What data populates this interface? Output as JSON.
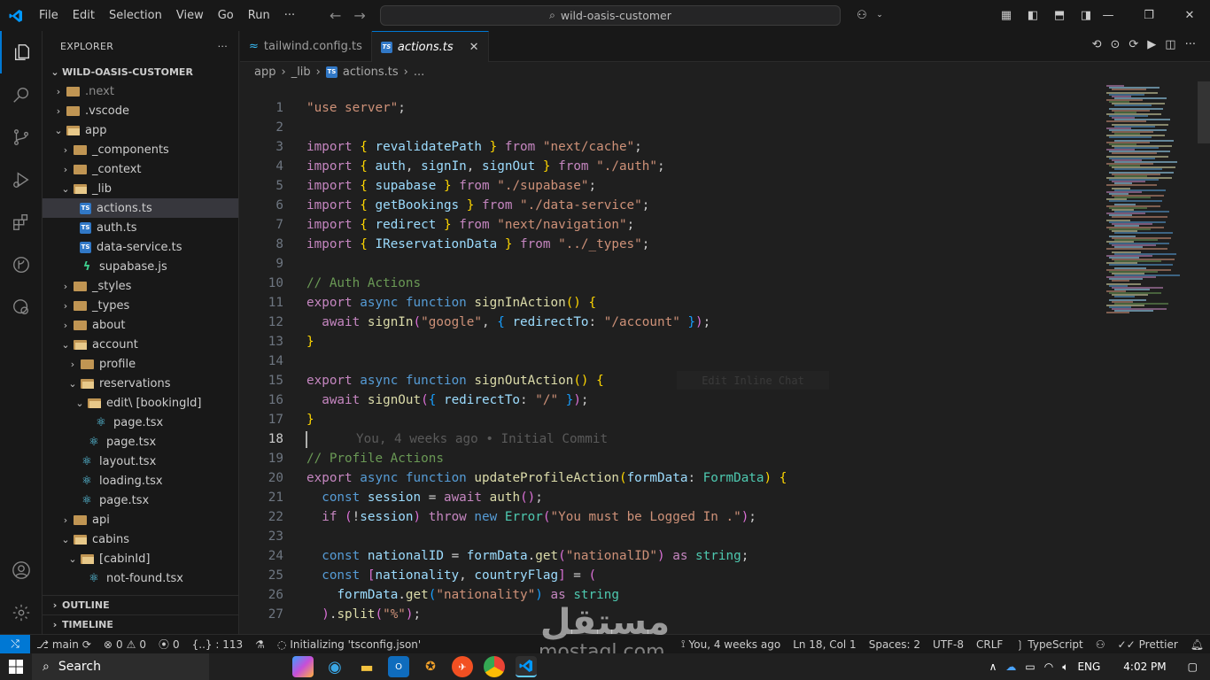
{
  "titlebar": {
    "menu": [
      "File",
      "Edit",
      "Selection",
      "View",
      "Go",
      "Run",
      "···"
    ],
    "command_center": "wild-oasis-customer"
  },
  "sidebar": {
    "title": "EXPLORER",
    "more": "···",
    "project": "WILD-OASIS-CUSTOMER",
    "tree": [
      {
        "label": ".next",
        "depth": 1,
        "chev": "›",
        "icon": "folder"
      },
      {
        "label": ".vscode",
        "depth": 1,
        "chev": "›",
        "icon": "folder"
      },
      {
        "label": "app",
        "depth": 1,
        "chev": "⌄",
        "icon": "folder-open"
      },
      {
        "label": "_components",
        "depth": 2,
        "chev": "›",
        "icon": "folder"
      },
      {
        "label": "_context",
        "depth": 2,
        "chev": "›",
        "icon": "folder"
      },
      {
        "label": "_lib",
        "depth": 2,
        "chev": "⌄",
        "icon": "folder-open"
      },
      {
        "label": "actions.ts",
        "depth": 3,
        "chev": "",
        "icon": "ts",
        "selected": true
      },
      {
        "label": "auth.ts",
        "depth": 3,
        "chev": "",
        "icon": "ts"
      },
      {
        "label": "data-service.ts",
        "depth": 3,
        "chev": "",
        "icon": "ts"
      },
      {
        "label": "supabase.js",
        "depth": 3,
        "chev": "",
        "icon": "supabase"
      },
      {
        "label": "_styles",
        "depth": 2,
        "chev": "›",
        "icon": "folder"
      },
      {
        "label": "_types",
        "depth": 2,
        "chev": "›",
        "icon": "folder"
      },
      {
        "label": "about",
        "depth": 2,
        "chev": "›",
        "icon": "folder"
      },
      {
        "label": "account",
        "depth": 2,
        "chev": "⌄",
        "icon": "folder-open"
      },
      {
        "label": "profile",
        "depth": 3,
        "chev": "›",
        "icon": "folder"
      },
      {
        "label": "reservations",
        "depth": 3,
        "chev": "⌄",
        "icon": "folder-open"
      },
      {
        "label": "edit\\ [bookingId]",
        "depth": 4,
        "chev": "⌄",
        "icon": "folder-open"
      },
      {
        "label": "page.tsx",
        "depth": 5,
        "chev": "",
        "icon": "react"
      },
      {
        "label": "page.tsx",
        "depth": 4,
        "chev": "",
        "icon": "react"
      },
      {
        "label": "layout.tsx",
        "depth": 3,
        "chev": "",
        "icon": "react"
      },
      {
        "label": "loading.tsx",
        "depth": 3,
        "chev": "",
        "icon": "react"
      },
      {
        "label": "page.tsx",
        "depth": 3,
        "chev": "",
        "icon": "react"
      },
      {
        "label": "api",
        "depth": 2,
        "chev": "›",
        "icon": "folder"
      },
      {
        "label": "cabins",
        "depth": 2,
        "chev": "⌄",
        "icon": "folder-open"
      },
      {
        "label": "[cabinId]",
        "depth": 3,
        "chev": "⌄",
        "icon": "folder-open"
      },
      {
        "label": "not-found.tsx",
        "depth": 4,
        "chev": "",
        "icon": "react"
      }
    ],
    "outline": "OUTLINE",
    "timeline": "TIMELINE"
  },
  "tabs": [
    {
      "label": "tailwind.config.ts",
      "active": false
    },
    {
      "label": "actions.ts",
      "active": true
    }
  ],
  "breadcrumb": [
    "app",
    "_lib",
    "actions.ts",
    "..."
  ],
  "editor": {
    "current_line": 18,
    "blame": "You, 4 weeks ago • Initial Commit",
    "ghost_chip": "Edit Inline Chat"
  },
  "statusbar": {
    "branch": "main",
    "errors": "0",
    "warnings": "0",
    "ports": "0",
    "scope": "{..} : 113",
    "initializing": "Initializing 'tsconfig.json'",
    "blame": "You, 4 weeks ago",
    "position": "Ln 18, Col 1",
    "spaces": "Spaces: 2",
    "encoding": "UTF-8",
    "eol": "CRLF",
    "language": "TypeScript",
    "prettier": "Prettier"
  },
  "taskbar": {
    "search": "Search",
    "lang": "ENG",
    "time": "4:02 PM"
  },
  "watermark": {
    "arabic": "مستقل",
    "latin": "mostaql.com"
  },
  "colors": {
    "accent": "#0078d4",
    "background": "#1f1f1f",
    "sidebar": "#181818"
  }
}
